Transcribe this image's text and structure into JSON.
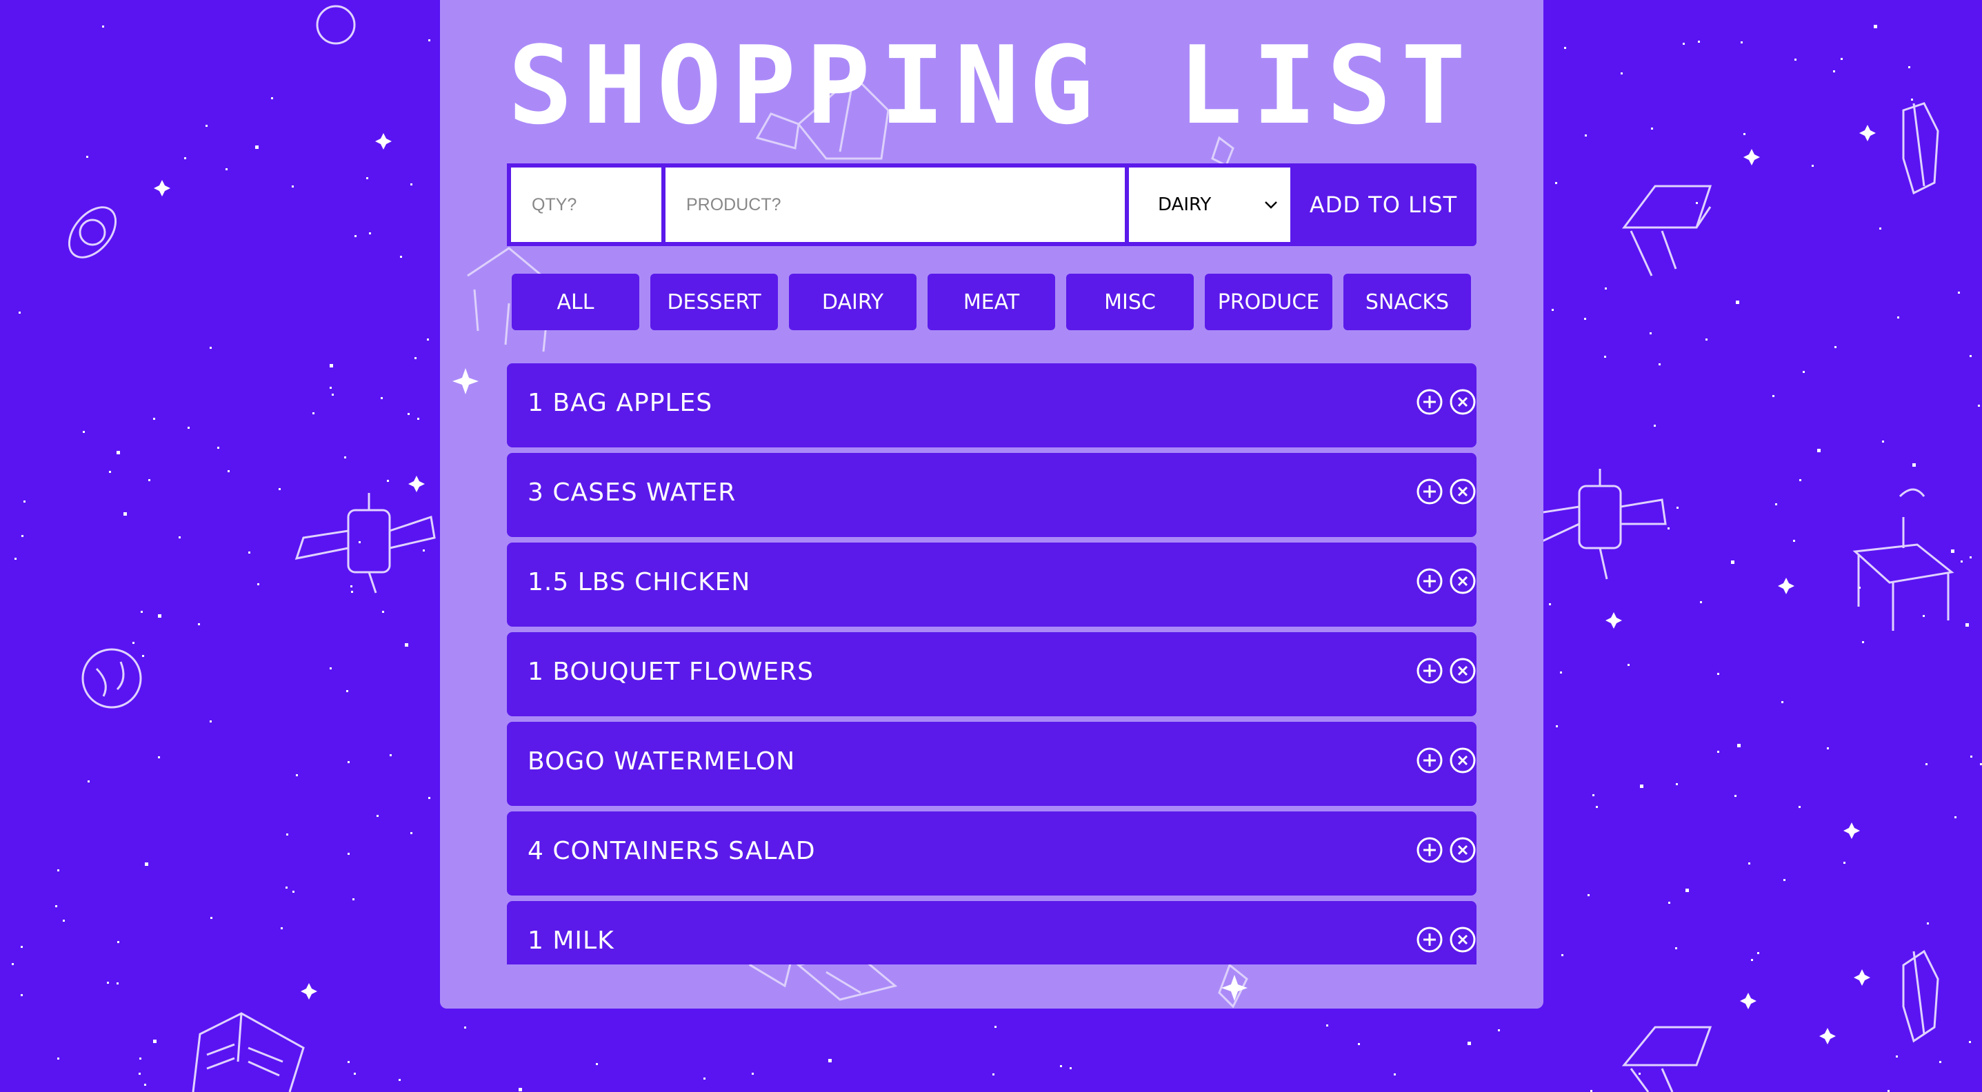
{
  "app": {
    "title": "SHOPPING LIST"
  },
  "colors": {
    "background": "#5a14f2",
    "panel": "#ab8af8",
    "accent": "#5b1aea",
    "text": "#ffffff"
  },
  "form": {
    "qty_placeholder": "QTY?",
    "product_placeholder": "PRODUCT?",
    "category_selected": "DAIRY",
    "add_label": "ADD TO LIST"
  },
  "filters": [
    "ALL",
    "DESSERT",
    "DAIRY",
    "MEAT",
    "MISC",
    "PRODUCE",
    "SNACKS"
  ],
  "items": [
    "1 BAG APPLES",
    "3 CASES WATER",
    "1.5 LBS CHICKEN",
    "1 BOUQUET FLOWERS",
    "BOGO WATERMELON",
    "4 CONTAINERS SALAD",
    "1 MILK"
  ],
  "icons": {
    "increment": "plus-circle-icon",
    "remove": "x-circle-icon",
    "select": "chevron-down-icon"
  }
}
